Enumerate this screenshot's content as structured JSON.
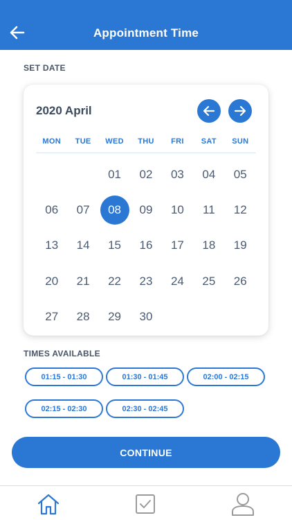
{
  "header": {
    "title": "Appointment Time",
    "back_icon": "arrow-left-icon"
  },
  "set_date_label": "SET DATE",
  "calendar": {
    "month_title": "2020 April",
    "prev_icon": "arrow-left-icon",
    "next_icon": "arrow-right-icon",
    "weekdays": [
      "MON",
      "TUE",
      "WED",
      "THU",
      "FRI",
      "SAT",
      "SUN"
    ],
    "days": [
      "",
      "",
      "01",
      "02",
      "03",
      "04",
      "05",
      "06",
      "07",
      "08",
      "09",
      "10",
      "11",
      "12",
      "13",
      "14",
      "15",
      "16",
      "17",
      "18",
      "19",
      "20",
      "21",
      "22",
      "23",
      "24",
      "25",
      "26",
      "27",
      "28",
      "29",
      "30"
    ],
    "selected_day": "08"
  },
  "times_label": "TIMES AVAILABLE",
  "time_slots": [
    "01:15 - 01:30",
    "01:30 - 01:45",
    "02:00 - 02:15",
    "02:15 - 02:30",
    "02:30 - 02:45"
  ],
  "continue_label": "CONTINUE",
  "tabbar": {
    "items": [
      {
        "icon": "home-icon",
        "active": true
      },
      {
        "icon": "checkbox-icon",
        "active": false
      },
      {
        "icon": "user-icon",
        "active": false
      }
    ]
  },
  "colors": {
    "accent": "#2b78d4",
    "text": "#4a5a70",
    "inactive_icon": "#9a9a9a"
  }
}
